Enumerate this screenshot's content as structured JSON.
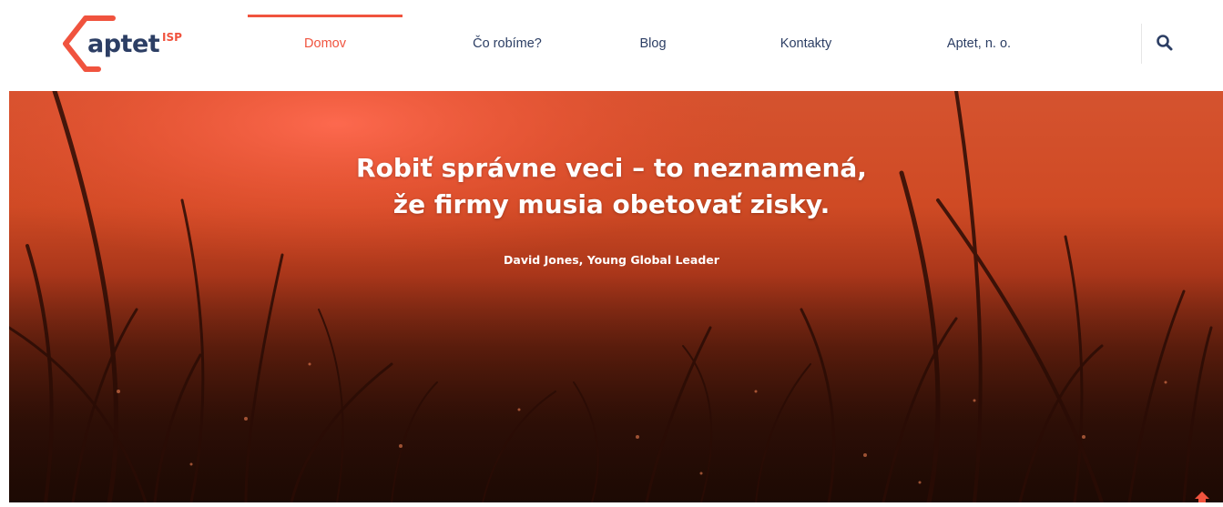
{
  "brand": {
    "name": "aptet",
    "suffix": "ISP"
  },
  "nav": {
    "items": [
      {
        "label": "Domov",
        "active": true
      },
      {
        "label": "Čo robíme?",
        "active": false
      },
      {
        "label": "Blog",
        "active": false
      },
      {
        "label": "Kontakty",
        "active": false
      },
      {
        "label": "Aptet, n. o.",
        "active": false
      }
    ],
    "search_icon": "search-icon"
  },
  "hero": {
    "quote_line1": "Robiť správne veci – to neznamená,",
    "quote_line2": "že firmy musia obetovať zisky.",
    "author": "David Jones, Young Global Leader"
  },
  "scroll_top_icon": "arrow-up-icon",
  "colors": {
    "accent": "#f0533e",
    "text_dark": "#2c3e64",
    "hero_top": "#d5532f",
    "hero_bottom": "#241006"
  }
}
